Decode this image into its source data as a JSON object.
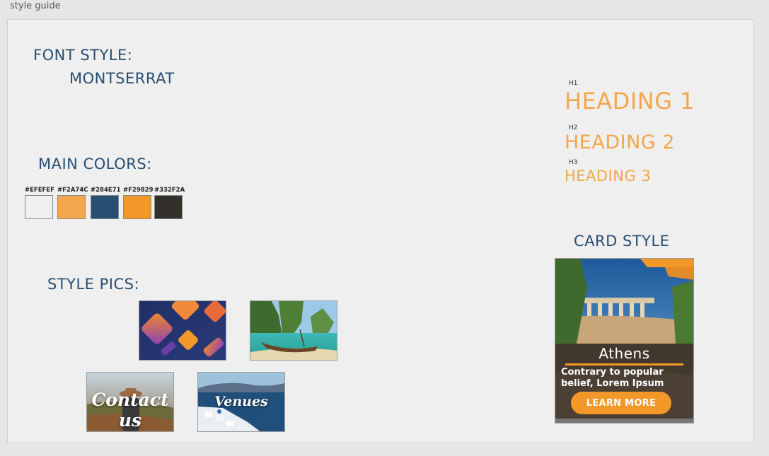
{
  "frame": {
    "label": "style guide"
  },
  "font_style": {
    "title": "FONT STYLE:",
    "font_name": "MONTSERRAT"
  },
  "main_colors": {
    "title": "MAIN COLORS:",
    "swatches": [
      {
        "hex": "#EFEFEF",
        "color": "#EFEFEF"
      },
      {
        "hex": "#F2A74C",
        "color": "#F2A74C"
      },
      {
        "hex": "#284E71",
        "color": "#284E71"
      },
      {
        "hex": "#F29829",
        "color": "#F29829"
      },
      {
        "hex": "#332F2A",
        "color": "#332F2A"
      }
    ]
  },
  "headings": {
    "h1_tag": "H1",
    "h1": "HEADING 1",
    "h2_tag": "H2",
    "h2": "HEADING 2",
    "h3_tag": "H3",
    "h3": "HEADING 3"
  },
  "style_pics": {
    "title": "STYLE PICS:",
    "pics": [
      {
        "name": "abstract-shapes"
      },
      {
        "name": "longtail-boat-beach"
      },
      {
        "name": "contact-us",
        "text": "Contact us"
      },
      {
        "name": "venues",
        "text": "Venues"
      }
    ]
  },
  "card_style": {
    "title": "CARD STYLE",
    "card_title": "Athens",
    "card_body": "Contrary to popular belief, Lorem Ipsum",
    "button_label": "LEARN MORE"
  }
}
